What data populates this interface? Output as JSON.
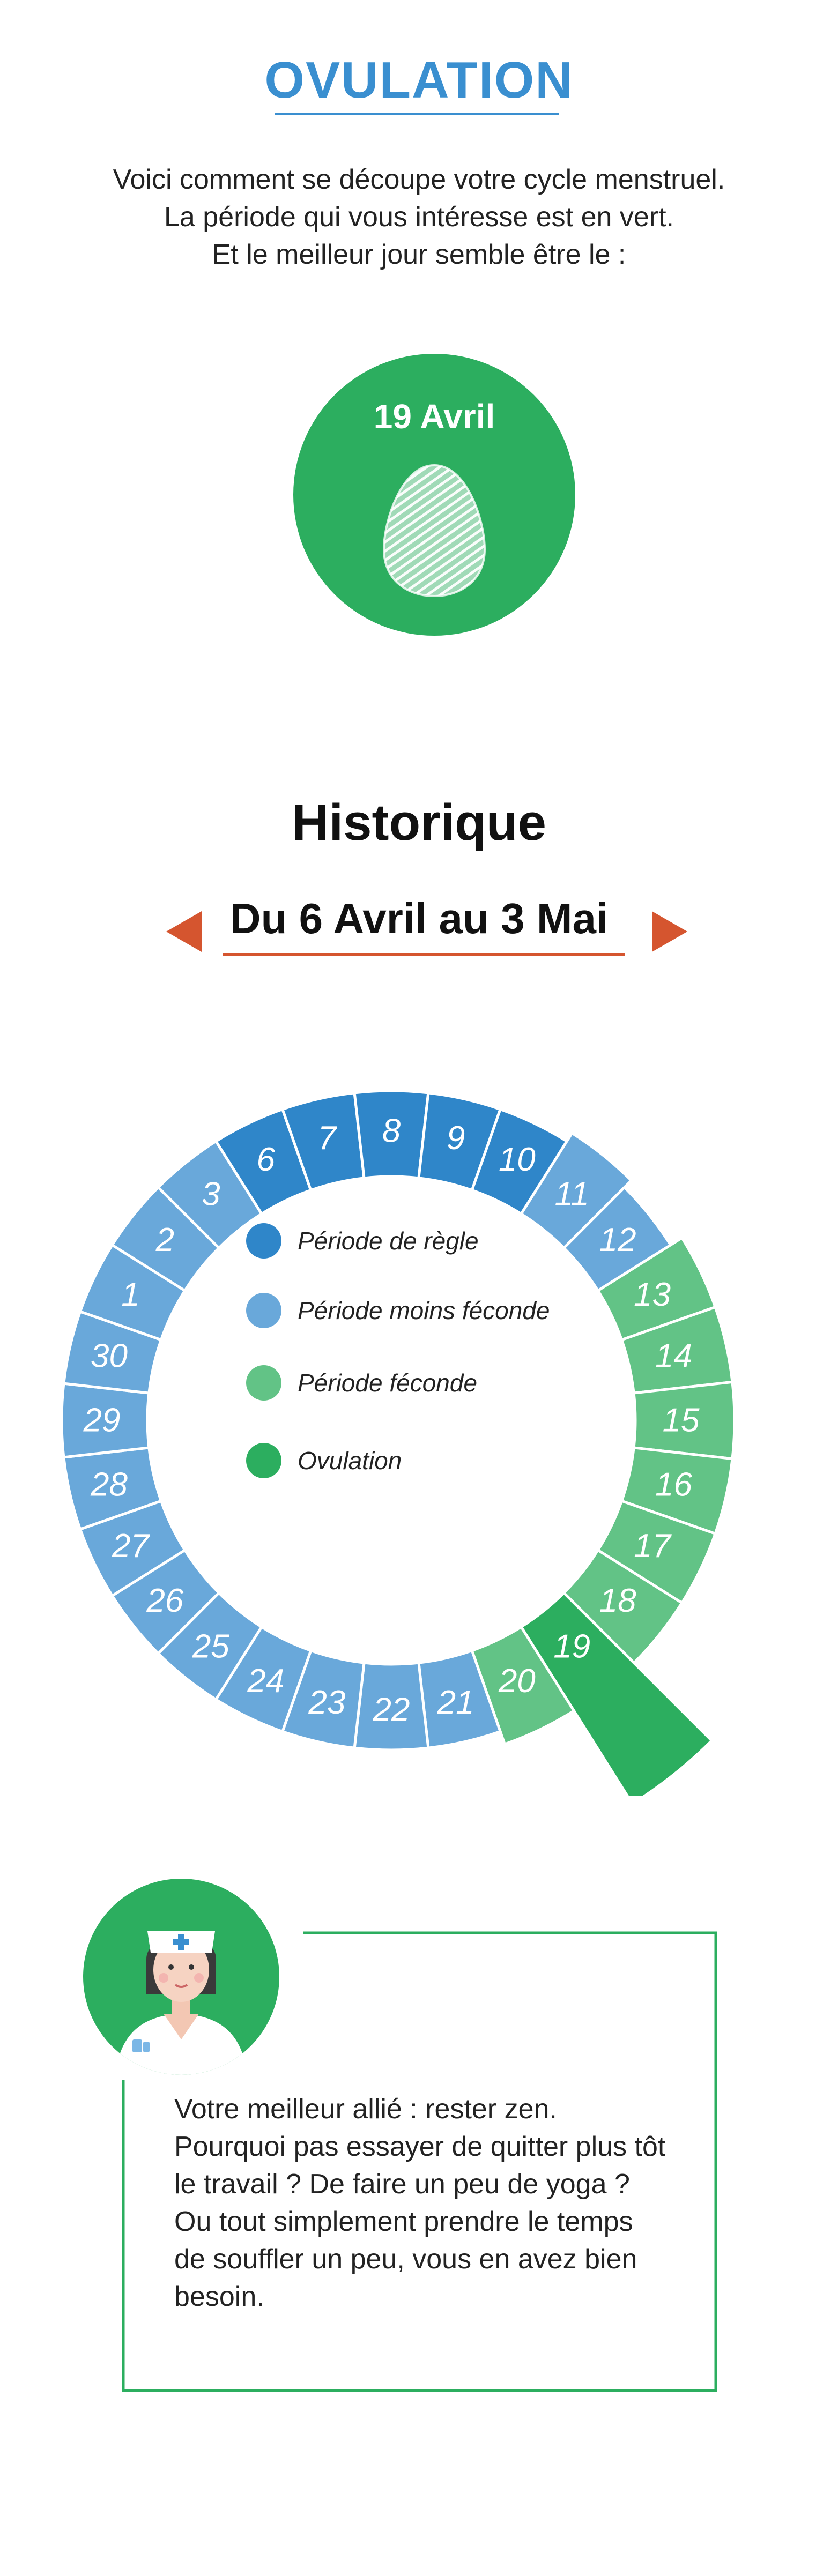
{
  "header": {
    "title": "OVULATION",
    "intro_lines": [
      "Voici comment se découpe votre cycle menstruel.",
      "La période qui vous intéresse est en vert.",
      "Et le meilleur jour semble être le :"
    ]
  },
  "ovulation": {
    "date": "19 Avril"
  },
  "history": {
    "title": "Historique",
    "range": "Du 6 Avril au 3 Mai",
    "prev_icon": "arrow-left-icon",
    "next_icon": "arrow-right-icon"
  },
  "cycle": {
    "days": [
      "6",
      "7",
      "8",
      "9",
      "10",
      "11",
      "12",
      "13",
      "14",
      "15",
      "16",
      "17",
      "18",
      "19",
      "20",
      "21",
      "22",
      "23",
      "24",
      "25",
      "26",
      "27",
      "28",
      "29",
      "30",
      "1",
      "2",
      "3"
    ],
    "phases": [
      "regle",
      "regle",
      "regle",
      "regle",
      "regle",
      "moins",
      "moins",
      "feconde",
      "feconde",
      "feconde",
      "feconde",
      "feconde",
      "feconde",
      "ovulation",
      "feconde",
      "moins",
      "moins",
      "moins",
      "moins",
      "moins",
      "moins",
      "moins",
      "moins",
      "moins",
      "moins",
      "moins",
      "moins",
      "moins"
    ],
    "colors": {
      "regle": "#2f86c9",
      "moins": "#69a8da",
      "feconde": "#62c386",
      "ovulation": "#2cae5f"
    },
    "legend": [
      {
        "key": "regle",
        "label": "Période de règle"
      },
      {
        "key": "moins",
        "label": "Période moins féconde"
      },
      {
        "key": "feconde",
        "label": "Période féconde"
      },
      {
        "key": "ovulation",
        "label": "Ovulation"
      }
    ]
  },
  "advice": {
    "icon": "nurse-avatar-icon",
    "lines": [
      "Votre meilleur allié : rester zen.",
      "Pourquoi pas essayer de quitter plus tôt",
      "le travail ? De faire un peu de yoga ?",
      "Ou tout simplement prendre le temps",
      "de souffler un peu, vous en avez bien",
      "besoin."
    ]
  }
}
